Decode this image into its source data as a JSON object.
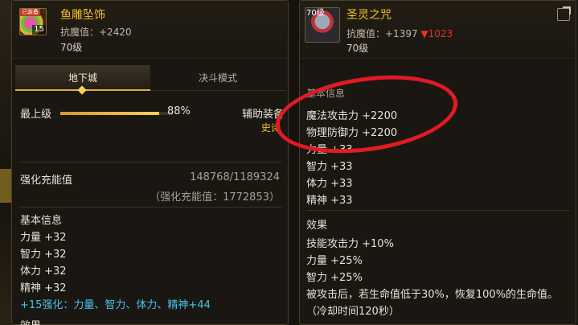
{
  "left_panel": {
    "icon": {
      "name": "pendant-icon",
      "tag": "已装备",
      "level_badge": "15"
    },
    "item_name": "鱼雕坠饰",
    "magic_resist": "抗魔值：+2420",
    "level": "70级",
    "tabs": [
      {
        "label": "地下城",
        "active": true
      },
      {
        "label": "决斗模式",
        "active": false
      }
    ],
    "grade": {
      "label": "最上级",
      "percent_text": "88%",
      "percent": 88
    },
    "assist_label": "辅助装备",
    "assist_sub": "史诗",
    "enhance": {
      "label": "强化充能值",
      "value": "148768/1189324",
      "sub": "（强化充能值：1772853）"
    },
    "basic_info_title": "基本信息",
    "stats": [
      "力量 +32",
      "智力 +32",
      "体力 +32",
      "精神 +32"
    ],
    "bonus": "+15强化：力量、智力、体力、精神+44",
    "next_title": "效果"
  },
  "right_panel": {
    "icon": {
      "name": "holy-spirit-charm-icon",
      "level_badge": "70级"
    },
    "item_name": "圣灵之咒",
    "magic_resist_prefix": "抗魔值：+1397 ",
    "magic_resist_diff": "▼1023",
    "level": "70级",
    "basic_info_title": "基本信息",
    "stats": [
      "魔法攻击力 +2200",
      "物理防御力 +2200",
      "力量 +33",
      "智力 +33",
      "体力 +33",
      "精神 +33"
    ],
    "effect_title": "效果",
    "effects": [
      "技能攻击力 +10%",
      "力量 +25%",
      "智力 +25%",
      "被攻击后，若生命值低于30%，恢复100%的生命值。",
      "（冷却时间120秒）"
    ]
  },
  "colors": {
    "name": "#f2c227",
    "accent": "#d9b24a",
    "bonus": "#47c2f0",
    "annotation": "#e11a24",
    "down": "#e2342c"
  }
}
